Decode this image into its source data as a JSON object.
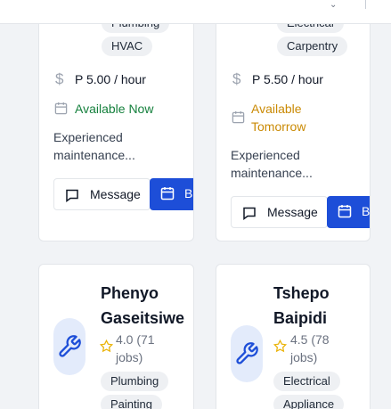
{
  "cards": [
    {
      "tags": [
        "Plumbing",
        "HVAC"
      ],
      "rate": "P 5.00 / hour",
      "availability": "Available Now",
      "availability_color": "#15803d",
      "description": [
        "Experienced",
        "maintenance..."
      ],
      "message_label": "Message",
      "book_label": "Book"
    },
    {
      "tags": [
        "Electrical",
        "Carpentry"
      ],
      "rate": "P 5.50 / hour",
      "availability": [
        "Available",
        "Tomorrow"
      ],
      "availability_color": "#ca8a04",
      "description": [
        "Experienced",
        "maintenance..."
      ],
      "message_label": "Message",
      "book_label": "Book"
    },
    {
      "name": [
        "Phenyo",
        "Gaseitsiwe"
      ],
      "rating": [
        "4.0 (71",
        "jobs)"
      ],
      "tags": [
        "Plumbing",
        "Painting"
      ]
    },
    {
      "name": [
        "Tshepo",
        "Baipidi"
      ],
      "rating": [
        "4.5 (78",
        "jobs)"
      ],
      "tags": [
        "Electrical",
        "Appliance"
      ]
    }
  ],
  "colors": {
    "primary": "#1d4ed8",
    "star": "#eab308"
  },
  "icons": [
    "dollar-icon",
    "calendar-icon",
    "message-icon",
    "wrench-icon",
    "star-icon",
    "chevron-down-icon"
  ]
}
